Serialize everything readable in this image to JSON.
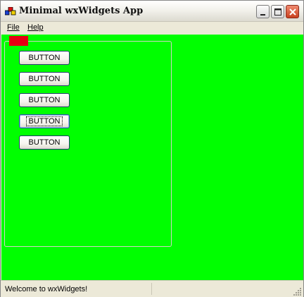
{
  "window": {
    "title": "Minimal wxWidgets App",
    "icons": {
      "app": "wx-app-icon",
      "minimize": "minimize-icon",
      "maximize": "maximize-icon",
      "close": "close-icon"
    }
  },
  "menubar": {
    "items": [
      {
        "label": "File"
      },
      {
        "label": "Help"
      }
    ]
  },
  "client": {
    "background": "#00FF00",
    "red_block_color": "#E60012",
    "buttons": [
      {
        "label": "BUTTON",
        "focused": false
      },
      {
        "label": "BUTTON",
        "focused": false
      },
      {
        "label": "BUTTON",
        "focused": false
      },
      {
        "label": "BUTTON",
        "focused": true
      },
      {
        "label": "BUTTON",
        "focused": false
      }
    ]
  },
  "statusbar": {
    "text": "Welcome to wxWidgets!",
    "second_pane_text": ""
  }
}
